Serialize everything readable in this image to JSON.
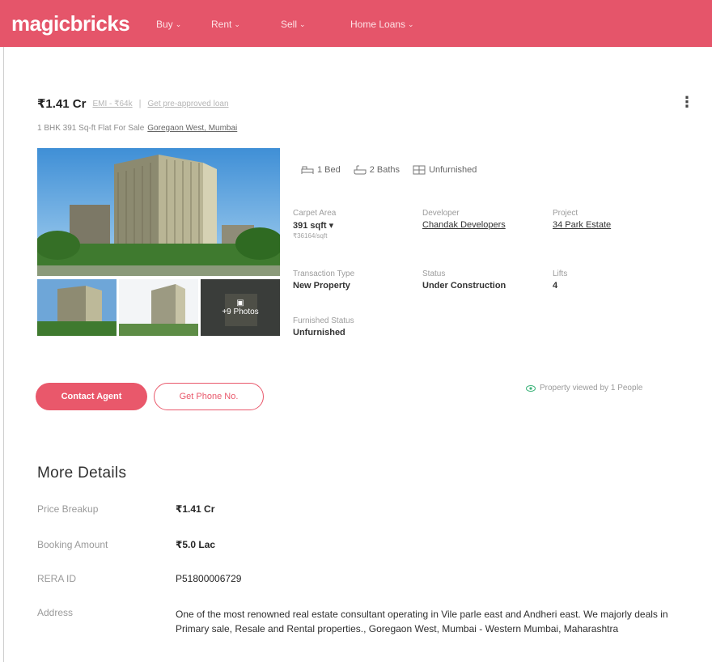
{
  "brand": {
    "logo": "magicbricks",
    "color": "#e5556a"
  },
  "nav": [
    {
      "label": "Buy"
    },
    {
      "label": "Rent"
    },
    {
      "label": "Sell"
    },
    {
      "label": "Home Loans"
    }
  ],
  "listing": {
    "price": "₹1.41 Cr",
    "emi_link": "EMI - ₹64k",
    "separator": "|",
    "loan_link": "Get pre-approved loan",
    "subtitle": "1 BHK 391 Sq-ft Flat For Sale",
    "location_link": "Goregaon West, Mumbai",
    "more_photos": "+9 Photos",
    "amenities": [
      {
        "icon": "bed-icon",
        "label": "1 Bed"
      },
      {
        "icon": "bath-icon",
        "label": "2 Baths"
      },
      {
        "icon": "furnishing-icon",
        "label": "Unfurnished"
      }
    ],
    "summary": {
      "carpet_area_label": "Carpet Area",
      "carpet_area_value": "391 sqft",
      "carpet_area_caret": "▾",
      "rate": "₹36164/sqft",
      "developer_label": "Developer",
      "developer_value": "Chandak Developers",
      "project_label": "Project",
      "project_value": "34 Park Estate",
      "transaction_label": "Transaction Type",
      "transaction_value": "New Property",
      "status_label": "Status",
      "status_value": "Under Construction",
      "lifts_label": "Lifts",
      "lifts_value": "4",
      "furnished_label": "Furnished Status",
      "furnished_value": "Unfurnished"
    },
    "contact_button": "Contact Agent",
    "phone_button": "Get Phone No.",
    "viewed_text": "Property viewed by 1 People"
  },
  "more_details": {
    "title": "More Details",
    "rows": [
      {
        "label": "Price Breakup",
        "value": "₹1.41 Cr"
      },
      {
        "label": "Booking Amount",
        "value": "₹5.0 Lac"
      },
      {
        "label": "RERA ID",
        "value": "P51800006729"
      },
      {
        "label": "Address",
        "value": "One of the most renowned real estate consultant operating in Vile parle east and Andheri east. We majorly deals in Primary sale, Resale and Rental properties., Goregaon West, Mumbai - Western Mumbai, Maharashtra"
      }
    ]
  },
  "colors": {
    "accent": "#e9586b",
    "link": "#b5b5b5",
    "viewed_icon": "#3db37a"
  }
}
